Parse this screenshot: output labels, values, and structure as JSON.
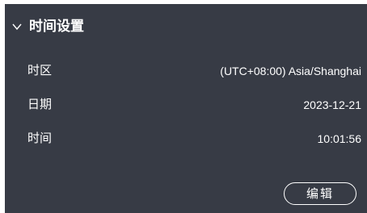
{
  "section": {
    "title": "时间设置",
    "expanded": true
  },
  "rows": [
    {
      "label": "时区",
      "value": "(UTC+08:00) Asia/Shanghai"
    },
    {
      "label": "日期",
      "value": "2023-12-21"
    },
    {
      "label": "时间",
      "value": "10:01:56"
    }
  ],
  "actions": {
    "edit_label": "编辑"
  },
  "colors": {
    "panel_background": "#373b45",
    "text": "#ffffff"
  },
  "icons": {
    "collapse": "chevron-down-icon"
  }
}
